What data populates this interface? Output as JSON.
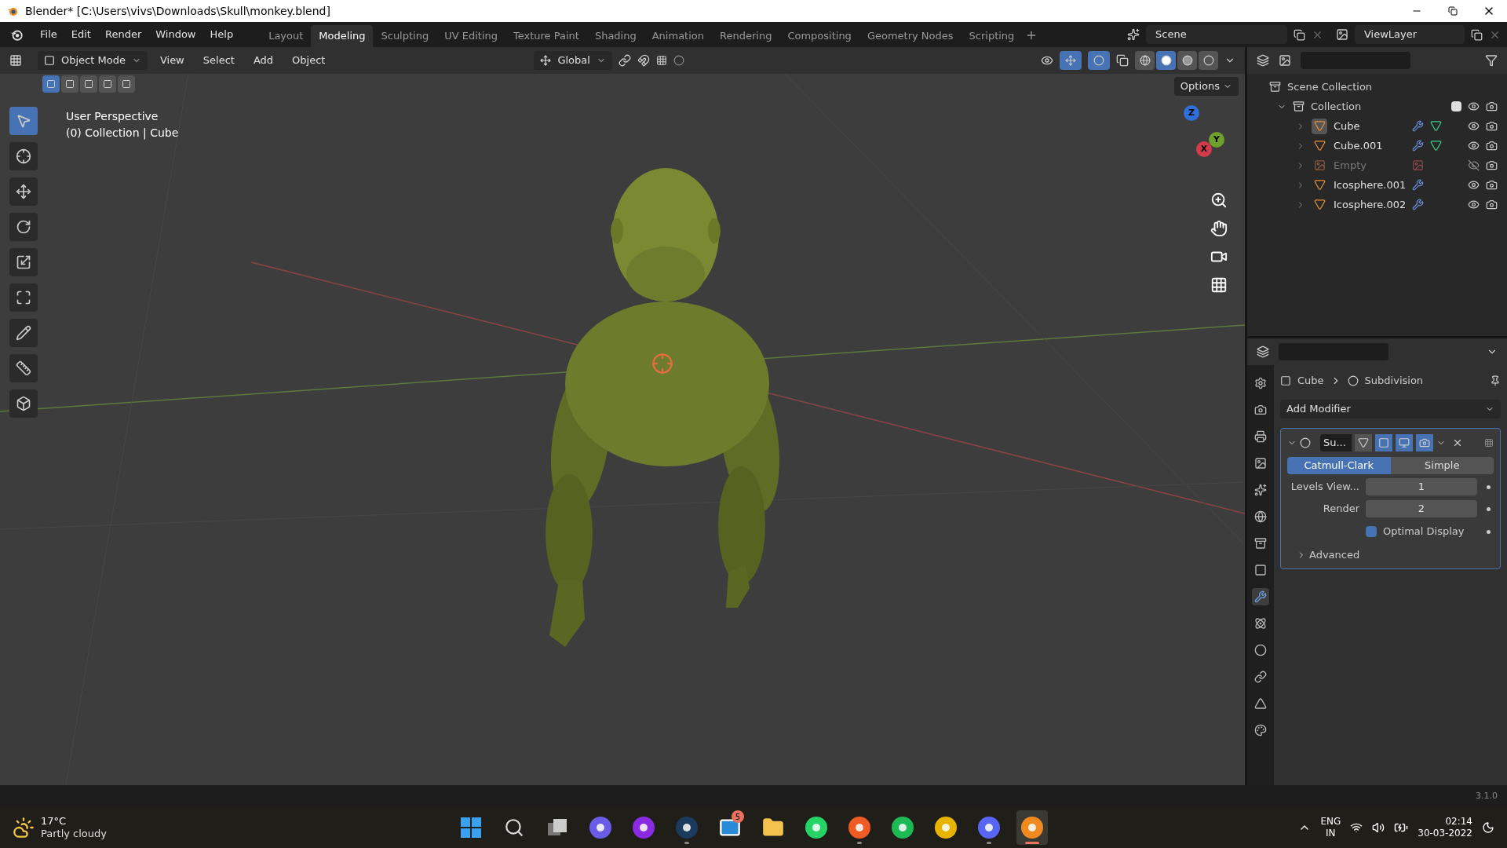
{
  "window": {
    "title": "Blender* [C:\\Users\\vivs\\Downloads\\Skull\\monkey.blend]"
  },
  "menu": [
    "File",
    "Edit",
    "Render",
    "Window",
    "Help"
  ],
  "workspaces": [
    {
      "label": "Layout",
      "selected": false
    },
    {
      "label": "Modeling",
      "selected": true
    },
    {
      "label": "Sculpting",
      "selected": false
    },
    {
      "label": "UV Editing",
      "selected": false
    },
    {
      "label": "Texture Paint",
      "selected": false
    },
    {
      "label": "Shading",
      "selected": false
    },
    {
      "label": "Animation",
      "selected": false
    },
    {
      "label": "Rendering",
      "selected": false
    },
    {
      "label": "Compositing",
      "selected": false
    },
    {
      "label": "Geometry Nodes",
      "selected": false
    },
    {
      "label": "Scripting",
      "selected": false
    }
  ],
  "scene": "Scene",
  "view_layer": "ViewLayer",
  "viewport": {
    "gizmos_on": true,
    "overlays_on": true,
    "mode": "Object Mode",
    "menus": [
      "View",
      "Select",
      "Add",
      "Object"
    ],
    "orientation": "Global",
    "options": "Options",
    "select_modes": [
      {
        "selected": true
      },
      {
        "selected": false
      },
      {
        "selected": false
      },
      {
        "selected": false
      },
      {
        "selected": false
      }
    ],
    "shading": [
      {
        "kind": "wireframe",
        "selected": false
      },
      {
        "kind": "solid",
        "selected": true
      },
      {
        "kind": "material",
        "selected": false
      },
      {
        "kind": "rendered",
        "selected": false
      }
    ],
    "overlay_text": [
      "User Perspective",
      "(0) Collection | Cube"
    ],
    "gizmo": [
      "Z",
      "Y",
      "X"
    ],
    "tools": [
      {
        "kind": "select",
        "selected": true
      },
      {
        "kind": "cursor",
        "selected": false
      },
      {
        "kind": "move",
        "selected": false
      },
      {
        "kind": "rotate",
        "selected": false
      },
      {
        "kind": "scale",
        "selected": false
      },
      {
        "kind": "transform",
        "selected": false
      },
      {
        "kind": "annotate",
        "selected": false
      },
      {
        "kind": "measure",
        "selected": false
      },
      {
        "kind": "add-cube",
        "selected": false
      }
    ]
  },
  "outliner": {
    "scene_collection": "Scene Collection",
    "collection": {
      "name": "Collection",
      "expanded": true,
      "checked": true,
      "children": [
        {
          "name": "Cube",
          "kind": "mesh",
          "selected": true,
          "modifier": true,
          "mesh_data": true,
          "visible": true
        },
        {
          "name": "Cube.001",
          "kind": "mesh",
          "selected": false,
          "modifier": true,
          "mesh_data": true,
          "visible": true
        },
        {
          "name": "Empty",
          "kind": "empty",
          "selected": false,
          "modifier": false,
          "mesh_data": false,
          "visible": false
        },
        {
          "name": "Icosphere.001",
          "kind": "mesh",
          "selected": false,
          "modifier": true,
          "mesh_data": false,
          "visible": true
        },
        {
          "name": "Icosphere.002",
          "kind": "mesh",
          "selected": false,
          "modifier": true,
          "mesh_data": false,
          "visible": true
        }
      ]
    }
  },
  "properties": {
    "tabs": [
      {
        "kind": "tool",
        "selected": false
      },
      {
        "kind": "render",
        "selected": false
      },
      {
        "kind": "output",
        "selected": false
      },
      {
        "kind": "view-layer",
        "selected": false
      },
      {
        "kind": "scene",
        "selected": false
      },
      {
        "kind": "world",
        "selected": false
      },
      {
        "kind": "collection",
        "selected": false
      },
      {
        "kind": "object",
        "selected": false
      },
      {
        "kind": "modifier",
        "selected": true
      },
      {
        "kind": "particles",
        "selected": false
      },
      {
        "kind": "physics",
        "selected": false
      },
      {
        "kind": "constraints",
        "selected": false
      },
      {
        "kind": "data",
        "selected": false
      },
      {
        "kind": "material",
        "selected": false
      }
    ],
    "breadcrumb": [
      "Cube",
      "Subdivision"
    ],
    "add_modifier": "Add Modifier",
    "modifier": {
      "name": "Su...",
      "expanded": true,
      "on_cage": false,
      "edit_mode": true,
      "viewport": true,
      "render": true,
      "algorithms": [
        {
          "label": "Catmull-Clark",
          "selected": true
        },
        {
          "label": "Simple",
          "selected": false
        }
      ],
      "fields": [
        {
          "label": "Levels View...",
          "value": "1"
        },
        {
          "label": "Render",
          "value": "2"
        }
      ],
      "optimal_display": {
        "label": "Optimal Display",
        "checked": true
      },
      "advanced": {
        "label": "Advanced",
        "expanded": false
      }
    }
  },
  "status_bar": {
    "version": "3.1.0"
  },
  "taskbar": {
    "weather": {
      "temperature": "17°C",
      "condition": "Partly cloudy"
    },
    "apps": [
      {
        "kind": "start",
        "running": false,
        "active": false
      },
      {
        "kind": "search",
        "running": false,
        "active": false
      },
      {
        "kind": "task-view",
        "running": false,
        "active": false
      },
      {
        "kind": "chat",
        "running": false,
        "active": false
      },
      {
        "kind": "podcast",
        "running": false,
        "active": false
      },
      {
        "kind": "steam",
        "running": true,
        "active": false
      },
      {
        "kind": "mail",
        "running": false,
        "active": false,
        "badge": "5"
      },
      {
        "kind": "folder",
        "running": false,
        "active": false
      },
      {
        "kind": "whatsapp",
        "running": false,
        "active": false
      },
      {
        "kind": "brave",
        "running": true,
        "active": false
      },
      {
        "kind": "spotify",
        "running": false,
        "active": false
      },
      {
        "kind": "chrome",
        "running": false,
        "active": false
      },
      {
        "kind": "discord",
        "running": true,
        "active": false
      },
      {
        "kind": "blender",
        "running": true,
        "active": true
      }
    ],
    "language": [
      "ENG",
      "IN"
    ],
    "time": "02:14",
    "date": "30-03-2022"
  }
}
